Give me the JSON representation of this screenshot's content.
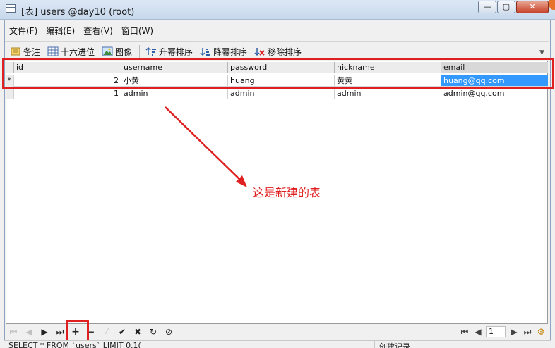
{
  "window": {
    "title": "[表] users @day10 (root)",
    "min_label": "—",
    "max_label": "▢",
    "close_label": "✕"
  },
  "menu": [
    {
      "label": "文件(F)"
    },
    {
      "label": "编辑(E)"
    },
    {
      "label": "查看(V)"
    },
    {
      "label": "窗口(W)"
    }
  ],
  "toolbar": {
    "memo": "备注",
    "hex": "十六进位",
    "image": "图像",
    "sort_asc": "升幂排序",
    "sort_desc": "降幂排序",
    "remove_sort": "移除排序"
  },
  "grid": {
    "columns": [
      "id",
      "username",
      "password",
      "nickname",
      "email"
    ],
    "rows": [
      {
        "marker": "*",
        "id": "2",
        "username": "小黄",
        "password": "huang",
        "nickname": "黄黄",
        "email": "huang@qq.com"
      },
      {
        "marker": "",
        "id": "1",
        "username": "admin",
        "password": "admin",
        "nickname": "admin",
        "email": "admin@qq.com"
      }
    ]
  },
  "annotation": "这是新建的表",
  "navigator": {
    "buttons": [
      "⏮",
      "◀",
      "▶",
      "⏭",
      "+",
      "−",
      "⁄",
      "✔",
      "✖",
      "↻",
      "⊘"
    ],
    "page": "1"
  },
  "status": {
    "sql": "SELECT * FROM `users` LIMIT 0,1(",
    "right": "创建记录"
  }
}
